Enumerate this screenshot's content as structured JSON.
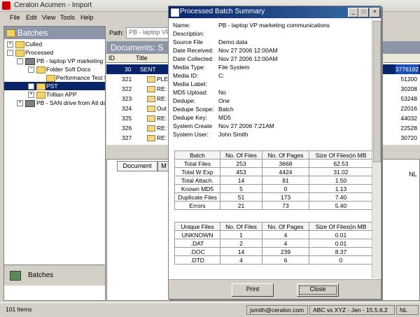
{
  "app": {
    "title": "Ceralon Acumen - Import"
  },
  "menu": [
    "File",
    "Edit",
    "View",
    "Tools",
    "Help"
  ],
  "left": {
    "header": "Batches",
    "tree": [
      {
        "label": "Culled",
        "depth": 0,
        "exp": "+"
      },
      {
        "label": "Processed",
        "depth": 0,
        "exp": "-"
      },
      {
        "label": "PB - laptop VP marketing c",
        "depth": 1,
        "exp": "-"
      },
      {
        "label": "Folder Soft Docs",
        "depth": 2,
        "exp": "-"
      },
      {
        "label": "Performance Test I",
        "depth": 3,
        "exp": ""
      },
      {
        "label": "PST",
        "depth": 2,
        "exp": "+"
      },
      {
        "label": "Trillian APP",
        "depth": 2,
        "exp": "+"
      },
      {
        "label": "PB - SAN drive from Atl data",
        "depth": 1,
        "exp": "+"
      }
    ],
    "footer_label": "Batches"
  },
  "right": {
    "path_label": "Path:",
    "path_value": "PB - laptop VP",
    "docs_header": "Documents: S",
    "columns": [
      "ID",
      "Title"
    ],
    "rows": [
      {
        "id": "30",
        "title": "SENT",
        "size": "3776192"
      },
      {
        "id": "321",
        "title": "PLE",
        "size": "51200"
      },
      {
        "id": "322",
        "title": "RE:",
        "size": "30208"
      },
      {
        "id": "323",
        "title": "RE:",
        "size": "53248"
      },
      {
        "id": "324",
        "title": "Out",
        "size": "22016"
      },
      {
        "id": "325",
        "title": "RE:",
        "size": "44032"
      },
      {
        "id": "326",
        "title": "RE:",
        "size": "22528"
      },
      {
        "id": "327",
        "title": "RE:",
        "size": "30720"
      }
    ],
    "tabs": [
      "Document",
      "M"
    ],
    "side_label": "NL"
  },
  "status": {
    "items": "101 Items",
    "user": "jsmith@ceralon.com",
    "case": "ABC vs XYZ - Jen - 15.5.6.2",
    "mode": "NL"
  },
  "dialog": {
    "title": "Processed Batch Summary",
    "props": [
      {
        "k": "Name:",
        "v": "PB - laptop VP marketing communications"
      },
      {
        "k": "Description:",
        "v": ""
      },
      {
        "k": "Source File",
        "v": "Demo data"
      },
      {
        "k": "Date Received:",
        "v": "Nov 27 2006 12:00AM"
      },
      {
        "k": "Date Collected:",
        "v": "Nov 27 2006 12:00AM"
      },
      {
        "k": "Media Type:",
        "v": "File System"
      },
      {
        "k": "Media ID:",
        "v": "C:"
      },
      {
        "k": "Media Label:",
        "v": ""
      },
      {
        "k": "MD5 Upload:",
        "v": "No"
      },
      {
        "k": "Dedupe:",
        "v": "One"
      },
      {
        "k": "Dedupe Scope:",
        "v": "Batch"
      },
      {
        "k": "Dedupe Key:",
        "v": "MD5"
      },
      {
        "k": "System Create",
        "v": "Nov 27 2006  7:21AM"
      },
      {
        "k": "System User:",
        "v": "John Smith"
      }
    ],
    "batch_table": {
      "headers": [
        "Batch",
        "No. Of Files",
        "No. Of Pages",
        "Size Of Files(in MB"
      ],
      "rows": [
        [
          "Total Files",
          "253",
          "3668",
          "62.53"
        ],
        [
          "Total W Exp",
          "453",
          "4424",
          "31.02"
        ],
        [
          "Total Attach.",
          "14",
          "81",
          "1.50"
        ],
        [
          "Known MD5",
          "5",
          "0",
          "1.13"
        ],
        [
          "Duplicate Files",
          "51",
          "173",
          "7.40"
        ],
        [
          "Errors",
          "21",
          "73",
          "5.40"
        ]
      ]
    },
    "unique_table": {
      "headers": [
        "Unique Files",
        "No. Of Files",
        "No. Of Pages",
        "Size Of Files(in MB"
      ],
      "rows": [
        [
          "UNKNOWN",
          "1",
          "4",
          "0.01"
        ],
        [
          ".DAT",
          "2",
          "4",
          "0.01"
        ],
        [
          ".DOC",
          "14",
          "239",
          "8.37"
        ],
        [
          ".DTD",
          "4",
          "6",
          "0"
        ]
      ]
    },
    "print_label": "Print",
    "close_label": "Close"
  }
}
